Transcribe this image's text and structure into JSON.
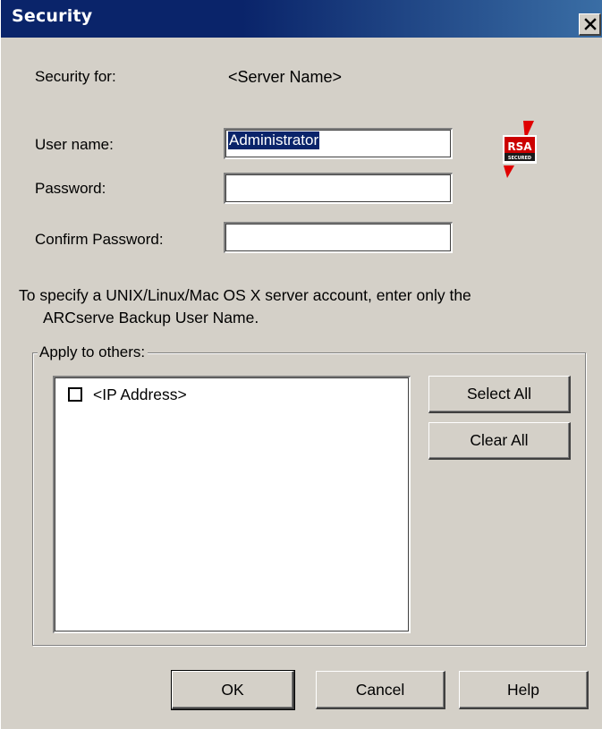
{
  "window": {
    "title": "Security",
    "close_label": "close"
  },
  "form": {
    "security_for_label": "Security for:",
    "server_name": "<Server Name>",
    "username_label": "User name:",
    "username_value": "Administrator",
    "password_label": "Password:",
    "password_value": "",
    "confirm_password_label": "Confirm Password:",
    "confirm_password_value": ""
  },
  "logo": {
    "name": "rsa-secured-icon",
    "text_top": "RSA",
    "text_bottom": "SECURED",
    "colors": {
      "badge": "#cc0000",
      "check": "#e00000"
    }
  },
  "info": {
    "line1": "To specify a UNIX/Linux/Mac OS X server account, enter only the",
    "line2": "ARCserve Backup User Name."
  },
  "apply_group": {
    "title": "Apply to others:",
    "items": [
      {
        "label": "<IP Address>",
        "checked": false
      }
    ],
    "select_all_label": "Select All",
    "clear_all_label": "Clear All"
  },
  "footer": {
    "ok_label": "OK",
    "cancel_label": "Cancel",
    "help_label": "Help"
  },
  "colors": {
    "dialog_bg": "#d4d0c8",
    "titlebar": "#0a246a",
    "selection": "#0a246a"
  }
}
